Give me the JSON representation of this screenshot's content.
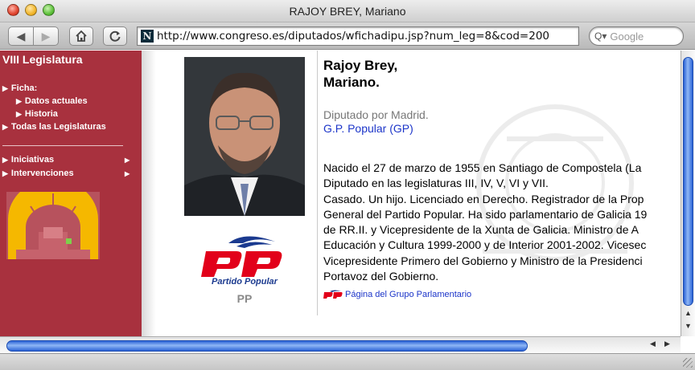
{
  "window": {
    "title": "RAJOY BREY, Mariano"
  },
  "toolbar": {
    "url": "http://www.congreso.es/diputados/wfichadipu.jsp?num_leg=8&cod=200",
    "search_placeholder": "Google",
    "favicon_letter": "N"
  },
  "sidebar": {
    "title": "VIII Legislatura",
    "items": [
      {
        "label": "Ficha:"
      },
      {
        "label": "Datos actuales"
      },
      {
        "label": "Historia"
      },
      {
        "label": "Todas las Legislaturas"
      },
      {
        "label": "Iniciativas"
      },
      {
        "label": "Intervenciones"
      }
    ]
  },
  "party": {
    "logo_text": "PP",
    "full_name": "Partido Popular",
    "short": "PP",
    "colors": {
      "red": "#e2001a",
      "blue": "#1b3a8f"
    }
  },
  "deputy": {
    "name_line1": "Rajoy Brey,",
    "name_line2": "Mariano.",
    "role": "Diputado por Madrid.",
    "group": "G.P. Popular (GP)",
    "bio": [
      "Nacido el 27 de marzo de 1955 en Santiago de Compostela (La",
      "Diputado en las legislaturas III, IV, V, VI y VII.",
      "Casado. Un hijo. Licenciado en Derecho. Registrador de la Prop",
      "General del Partido Popular. Ha sido parlamentario de Galicia 19",
      "de RR.II. y Vicepresidente de la Xunta de Galicia. Ministro de A",
      "Educación y Cultura 1999-2000 y de Interior 2001-2002. Vicesec",
      "Vicepresidente Primero del Gobierno y Ministro de la Presidenci",
      "Portavoz del Gobierno."
    ],
    "group_link": "Página del Grupo Parlamentario"
  },
  "colors": {
    "sidebar_bg": "#a8313e",
    "link": "#1c35c9",
    "hemicycle_seats": "#f5b800"
  }
}
